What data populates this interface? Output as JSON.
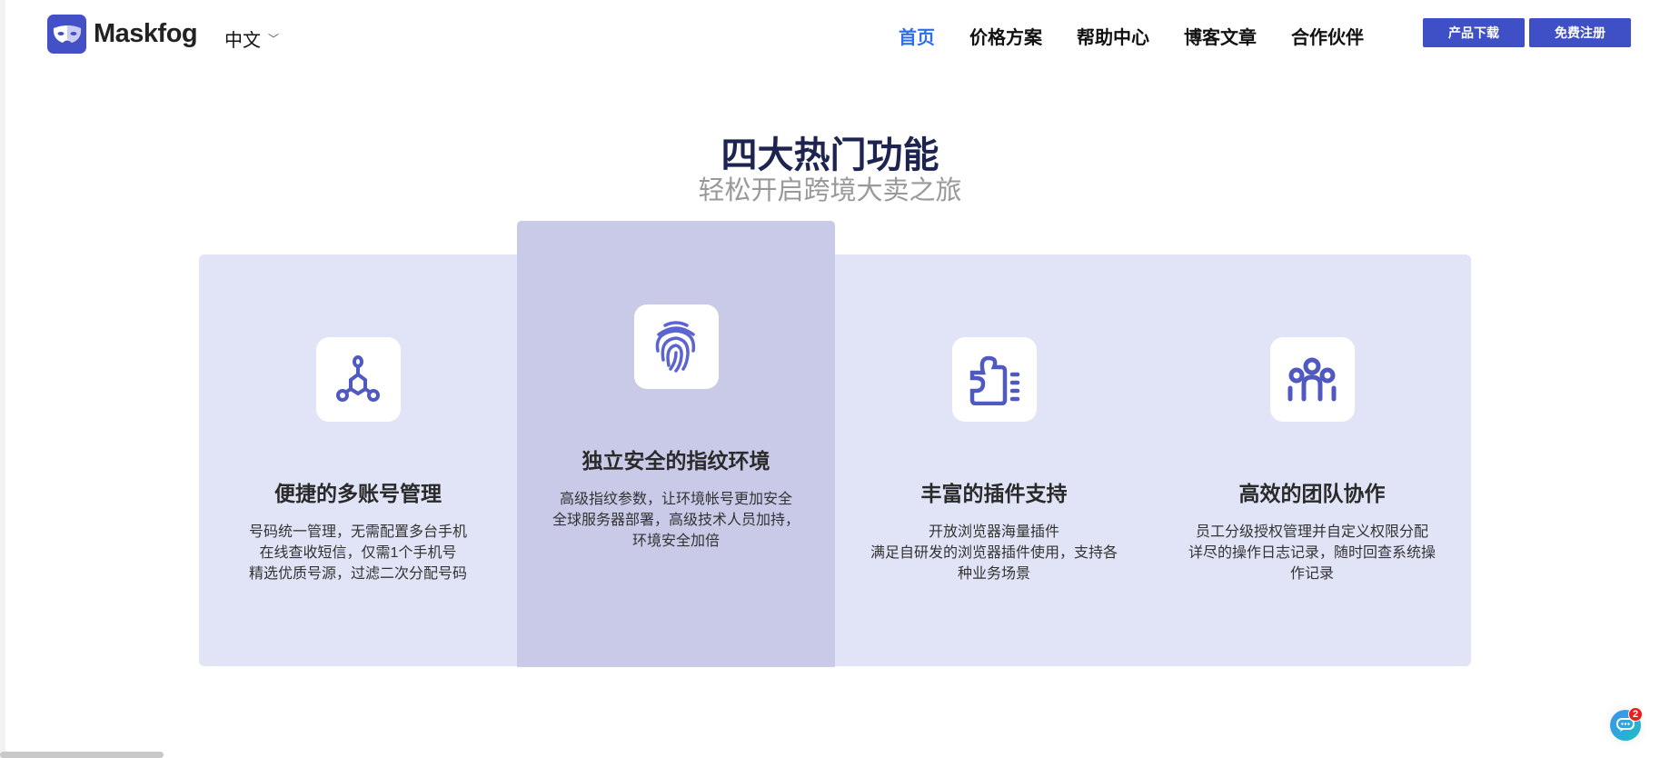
{
  "header": {
    "brand": "Maskfog",
    "language": "中文",
    "nav": [
      {
        "label": "首页",
        "active": true
      },
      {
        "label": "价格方案"
      },
      {
        "label": "帮助中心"
      },
      {
        "label": "博客文章"
      },
      {
        "label": "合作伙伴"
      }
    ],
    "download_label": "产品下载",
    "register_label": "免费注册"
  },
  "section": {
    "title": "四大热门功能",
    "subtitle": "轻松开启跨境大卖之旅",
    "cards": [
      {
        "icon": "network-icon",
        "title": "便捷的多账号管理",
        "lines": [
          "号码统一管理，无需配置多台手机",
          "在线查收短信，仅需1个手机号",
          "精选优质号源，过滤二次分配号码"
        ]
      },
      {
        "icon": "fingerprint-icon",
        "title": "独立安全的指纹环境",
        "lines": [
          "高级指纹参数，让环境帐号更加安全",
          "全球服务器部署，高级技术人员加持，",
          "环境安全加倍"
        ]
      },
      {
        "icon": "puzzle-icon",
        "title": "丰富的插件支持",
        "lines": [
          "开放浏览器海量插件",
          "满足自研发的浏览器插件使用，支持各",
          "种业务场景"
        ]
      },
      {
        "icon": "team-icon",
        "title": "高效的团队协作",
        "lines": [
          "员工分级授权管理并自定义权限分配",
          "详尽的操作日志记录，随时回查系统操",
          "作记录"
        ]
      }
    ]
  },
  "chat": {
    "badge": "2"
  },
  "colors": {
    "accent": "#3f4fc5",
    "nav_active": "#2f6ee9",
    "card_bg": "#e1e4f6",
    "card_highlight": "#c8cae8",
    "icon": "#5059c0"
  }
}
